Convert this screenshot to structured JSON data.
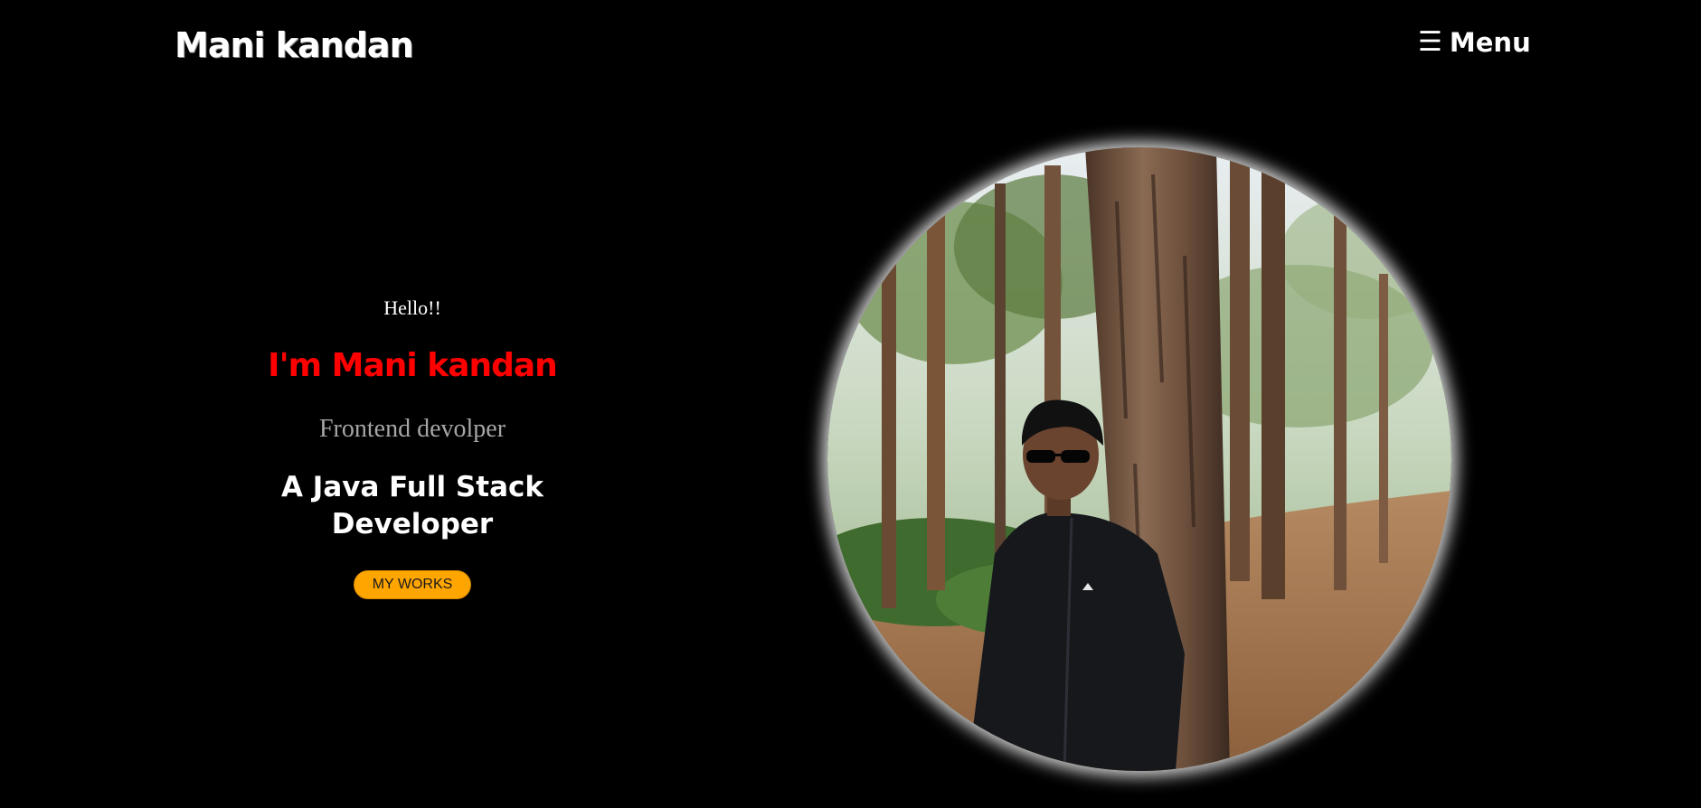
{
  "header": {
    "brand": "Mani kandan",
    "menu_icon": "hamburger-icon",
    "menu_label": "Menu"
  },
  "hero": {
    "greeting": "Hello!!",
    "name_line": "I'm Mani kandan",
    "role": "Frontend devolper",
    "headline": "A Java Full Stack Developer",
    "button_label": "MY WORKS"
  },
  "photo": {
    "subject": "profile-photo"
  },
  "colors": {
    "background": "#000000",
    "accent_red": "#ff0000",
    "button_orange": "#ffa500",
    "muted_text": "#a6a6a6"
  }
}
